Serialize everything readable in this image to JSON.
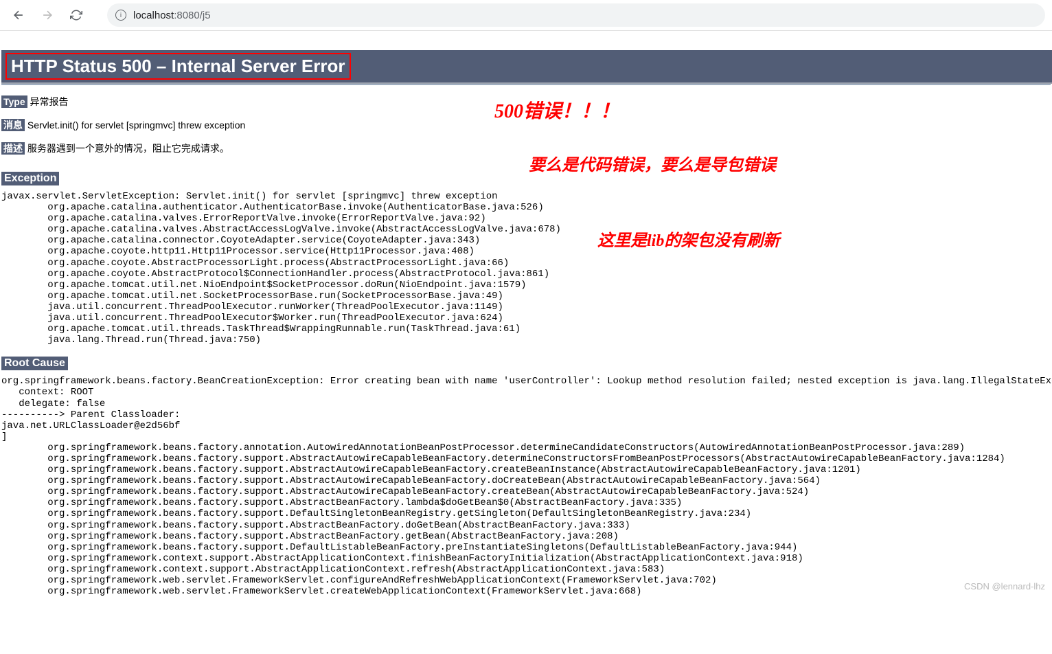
{
  "browser": {
    "url_host": "localhost",
    "url_port": ":8080",
    "url_path": "/j5"
  },
  "page": {
    "title": "HTTP Status 500 – Internal Server Error",
    "type_label": "Type",
    "type_value": " 异常报告",
    "message_label": "消息",
    "message_value": " Servlet.init() for servlet [springmvc] threw exception",
    "desc_label": "描述",
    "desc_value": " 服务器遇到一个意外的情况，阻止它完成请求。",
    "exception_header": "Exception",
    "exception_trace": "javax.servlet.ServletException: Servlet.init() for servlet [springmvc] threw exception\n        org.apache.catalina.authenticator.AuthenticatorBase.invoke(AuthenticatorBase.java:526)\n        org.apache.catalina.valves.ErrorReportValve.invoke(ErrorReportValve.java:92)\n        org.apache.catalina.valves.AbstractAccessLogValve.invoke(AbstractAccessLogValve.java:678)\n        org.apache.catalina.connector.CoyoteAdapter.service(CoyoteAdapter.java:343)\n        org.apache.coyote.http11.Http11Processor.service(Http11Processor.java:408)\n        org.apache.coyote.AbstractProcessorLight.process(AbstractProcessorLight.java:66)\n        org.apache.coyote.AbstractProtocol$ConnectionHandler.process(AbstractProtocol.java:861)\n        org.apache.tomcat.util.net.NioEndpoint$SocketProcessor.doRun(NioEndpoint.java:1579)\n        org.apache.tomcat.util.net.SocketProcessorBase.run(SocketProcessorBase.java:49)\n        java.util.concurrent.ThreadPoolExecutor.runWorker(ThreadPoolExecutor.java:1149)\n        java.util.concurrent.ThreadPoolExecutor$Worker.run(ThreadPoolExecutor.java:624)\n        org.apache.tomcat.util.threads.TaskThread$WrappingRunnable.run(TaskThread.java:61)\n        java.lang.Thread.run(Thread.java:750)",
    "rootcause_header": "Root Cause",
    "rootcause_trace": "org.springframework.beans.factory.BeanCreationException: Error creating bean with name 'userController': Lookup method resolution failed; nested exception is java.lang.IllegalStateException:\n   context: ROOT\n   delegate: false\n----------> Parent Classloader:\njava.net.URLClassLoader@e2d56bf\n]\n        org.springframework.beans.factory.annotation.AutowiredAnnotationBeanPostProcessor.determineCandidateConstructors(AutowiredAnnotationBeanPostProcessor.java:289)\n        org.springframework.beans.factory.support.AbstractAutowireCapableBeanFactory.determineConstructorsFromBeanPostProcessors(AbstractAutowireCapableBeanFactory.java:1284)\n        org.springframework.beans.factory.support.AbstractAutowireCapableBeanFactory.createBeanInstance(AbstractAutowireCapableBeanFactory.java:1201)\n        org.springframework.beans.factory.support.AbstractAutowireCapableBeanFactory.doCreateBean(AbstractAutowireCapableBeanFactory.java:564)\n        org.springframework.beans.factory.support.AbstractAutowireCapableBeanFactory.createBean(AbstractAutowireCapableBeanFactory.java:524)\n        org.springframework.beans.factory.support.AbstractBeanFactory.lambda$doGetBean$0(AbstractBeanFactory.java:335)\n        org.springframework.beans.factory.support.DefaultSingletonBeanRegistry.getSingleton(DefaultSingletonBeanRegistry.java:234)\n        org.springframework.beans.factory.support.AbstractBeanFactory.doGetBean(AbstractBeanFactory.java:333)\n        org.springframework.beans.factory.support.AbstractBeanFactory.getBean(AbstractBeanFactory.java:208)\n        org.springframework.beans.factory.support.DefaultListableBeanFactory.preInstantiateSingletons(DefaultListableBeanFactory.java:944)\n        org.springframework.context.support.AbstractApplicationContext.finishBeanFactoryInitialization(AbstractApplicationContext.java:918)\n        org.springframework.context.support.AbstractApplicationContext.refresh(AbstractApplicationContext.java:583)\n        org.springframework.web.servlet.FrameworkServlet.configureAndRefreshWebApplicationContext(FrameworkServlet.java:702)\n        org.springframework.web.servlet.FrameworkServlet.createWebApplicationContext(FrameworkServlet.java:668)"
  },
  "annotations": {
    "a1": "500错误！！！",
    "a2": "要么是代码错误，要么是导包错误",
    "a3": "这里是lib的架包没有刷新"
  },
  "watermark": "CSDN @lennard-lhz"
}
